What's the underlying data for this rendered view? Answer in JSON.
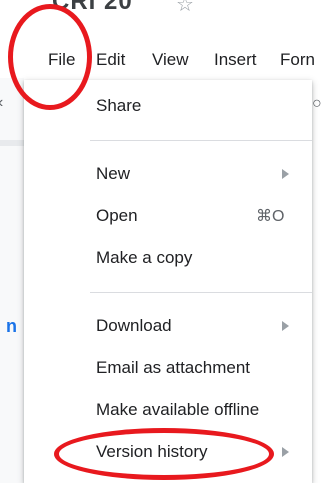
{
  "header": {
    "doc_title": "CRI 20",
    "star_icon": "star-icon"
  },
  "menubar": {
    "items": [
      "File",
      "Edit",
      "View",
      "Insert",
      "Forn"
    ]
  },
  "left": {
    "letter": "n"
  },
  "file_menu": {
    "items": [
      {
        "label": "Share"
      },
      {
        "label": "New",
        "submenu": true
      },
      {
        "label": "Open",
        "shortcut": "⌘O"
      },
      {
        "label": "Make a copy"
      },
      {
        "label": "Download",
        "submenu": true
      },
      {
        "label": "Email as attachment"
      },
      {
        "label": "Make available offline"
      },
      {
        "label": "Version history",
        "submenu": true
      }
    ]
  },
  "colors": {
    "annotation": "#e8191e",
    "accent": "#1a73e8"
  }
}
